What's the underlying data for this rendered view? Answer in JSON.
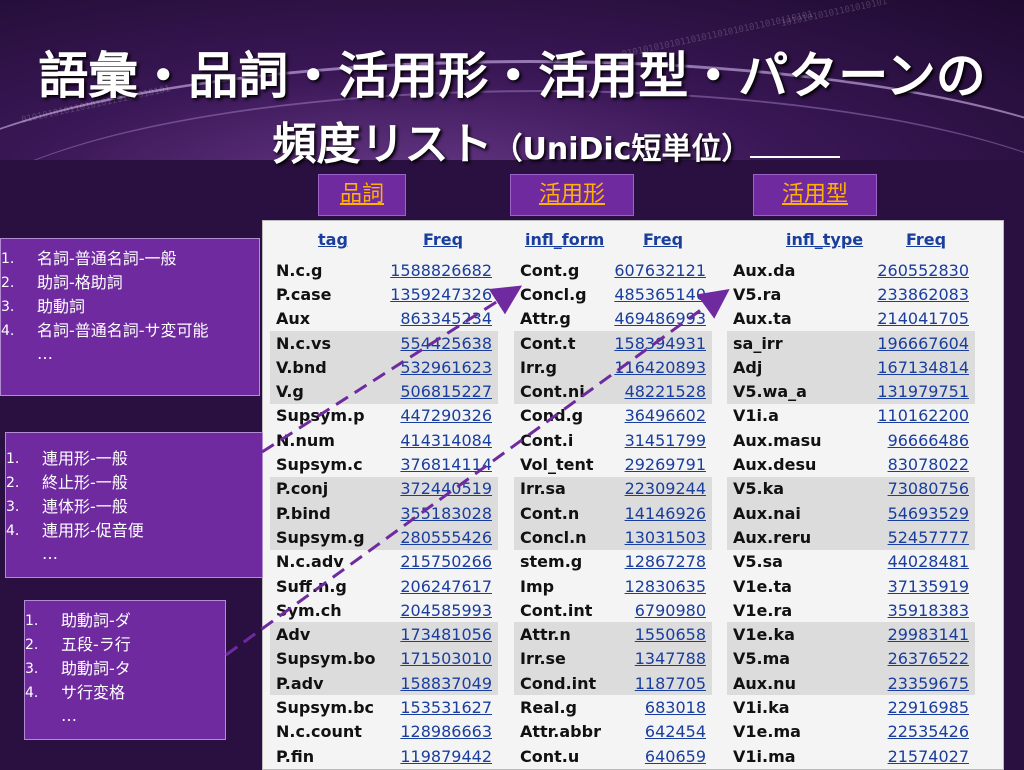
{
  "title": {
    "line1": "語彙・品詞・活用形・活用型・パターンの",
    "line2_main": "頻度リスト",
    "line2_paren": "（UniDic短単位）"
  },
  "headers": {
    "pos": "品詞",
    "infl_form": "活用形",
    "infl_type": "活用型"
  },
  "cols": {
    "tag": "tag",
    "freq": "Freq",
    "infl_form": "infl_form",
    "infl_type": "infl_type"
  },
  "pos_rows": [
    {
      "label": "N.c.g",
      "freq": "1588826682"
    },
    {
      "label": "P.case",
      "freq": "1359247326"
    },
    {
      "label": "Aux",
      "freq": "863345234"
    },
    {
      "label": "N.c.vs",
      "freq": "554425638"
    },
    {
      "label": "V.bnd",
      "freq": "532961623"
    },
    {
      "label": "V.g",
      "freq": "506815227"
    },
    {
      "label": "Supsym.p",
      "freq": "447290326"
    },
    {
      "label": "N.num",
      "freq": "414314084"
    },
    {
      "label": "Supsym.c",
      "freq": "376814114"
    },
    {
      "label": "P.conj",
      "freq": "372440519"
    },
    {
      "label": "P.bind",
      "freq": "355183028"
    },
    {
      "label": "Supsym.g",
      "freq": "280555426"
    },
    {
      "label": "N.c.adv",
      "freq": "215750266"
    },
    {
      "label": "Suff.n.g",
      "freq": "206247617"
    },
    {
      "label": "Sym.ch",
      "freq": "204585993"
    },
    {
      "label": "Adv",
      "freq": "173481056"
    },
    {
      "label": "Supsym.bo",
      "freq": "171503010"
    },
    {
      "label": "P.adv",
      "freq": "158837049"
    },
    {
      "label": "Supsym.bc",
      "freq": "153531627"
    },
    {
      "label": "N.c.count",
      "freq": "128986663"
    },
    {
      "label": "P.fin",
      "freq": "119879442"
    }
  ],
  "form_rows": [
    {
      "label": "Cont.g",
      "freq": "607632121"
    },
    {
      "label": "Concl.g",
      "freq": "485365140"
    },
    {
      "label": "Attr.g",
      "freq": "469486993"
    },
    {
      "label": "Cont.t",
      "freq": "158394931"
    },
    {
      "label": "Irr.g",
      "freq": "116420893"
    },
    {
      "label": "Cont.ni",
      "freq": "48221528"
    },
    {
      "label": "Cond.g",
      "freq": "36496602"
    },
    {
      "label": "Cont.i",
      "freq": "31451799"
    },
    {
      "label": "Vol_tent",
      "freq": "29269791"
    },
    {
      "label": "Irr.sa",
      "freq": "22309244"
    },
    {
      "label": "Cont.n",
      "freq": "14146926"
    },
    {
      "label": "Concl.n",
      "freq": "13031503"
    },
    {
      "label": "stem.g",
      "freq": "12867278"
    },
    {
      "label": "Imp",
      "freq": "12830635"
    },
    {
      "label": "Cont.int",
      "freq": "6790980"
    },
    {
      "label": "Attr.n",
      "freq": "1550658"
    },
    {
      "label": "Irr.se",
      "freq": "1347788"
    },
    {
      "label": "Cond.int",
      "freq": "1187705"
    },
    {
      "label": "Real.g",
      "freq": "683018"
    },
    {
      "label": "Attr.abbr",
      "freq": "642454"
    },
    {
      "label": "Cont.u",
      "freq": "640659"
    }
  ],
  "type_rows": [
    {
      "label": "Aux.da",
      "freq": "260552830"
    },
    {
      "label": "V5.ra",
      "freq": "233862083"
    },
    {
      "label": "Aux.ta",
      "freq": "214041705"
    },
    {
      "label": "sa_irr",
      "freq": "196667604"
    },
    {
      "label": "Adj",
      "freq": "167134814"
    },
    {
      "label": "V5.wa_a",
      "freq": "131979751"
    },
    {
      "label": "V1i.a",
      "freq": "110162200"
    },
    {
      "label": "Aux.masu",
      "freq": "96666486"
    },
    {
      "label": "Aux.desu",
      "freq": "83078022"
    },
    {
      "label": "V5.ka",
      "freq": "73080756"
    },
    {
      "label": "Aux.nai",
      "freq": "54693529"
    },
    {
      "label": "Aux.reru",
      "freq": "52457777"
    },
    {
      "label": "V5.sa",
      "freq": "44028481"
    },
    {
      "label": "V1e.ta",
      "freq": "37135919"
    },
    {
      "label": "V1e.ra",
      "freq": "35918383"
    },
    {
      "label": "V1e.ka",
      "freq": "29983141"
    },
    {
      "label": "V5.ma",
      "freq": "26376522"
    },
    {
      "label": "Aux.nu",
      "freq": "23359675"
    },
    {
      "label": "V1i.ka",
      "freq": "22916985"
    },
    {
      "label": "V1e.ma",
      "freq": "22535426"
    },
    {
      "label": "V1i.ma",
      "freq": "21574027"
    }
  ],
  "box1": {
    "items": [
      "名詞-普通名詞-一般",
      "助詞-格助詞",
      "助動詞",
      "名詞-普通名詞-サ変可能"
    ],
    "more": "…"
  },
  "box2": {
    "items": [
      "連用形-一般",
      "終止形-一般",
      "連体形-一般",
      "連用形-促音便"
    ],
    "more": "…"
  },
  "box3": {
    "items": [
      "助動詞-ダ",
      "五段-ラ行",
      "助動詞-タ",
      "サ行変格"
    ],
    "more": "…"
  },
  "colors": {
    "accent": "#6f2aa0",
    "link": "#1a3e9e",
    "header_text": "#ffb000",
    "arrow": "#6f2aa0"
  }
}
